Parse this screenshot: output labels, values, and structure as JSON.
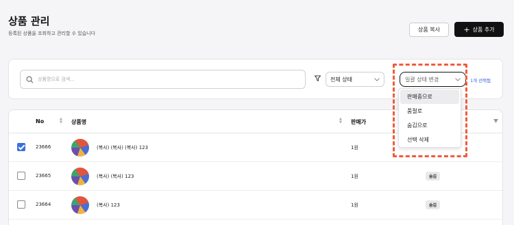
{
  "header": {
    "title": "상품 관리",
    "subtitle": "등록된 상품을 조회하고 관리할 수 있습니다",
    "copy_button": "상품 복사",
    "add_button": "상품 추가",
    "add_icon": "plus-icon"
  },
  "filters": {
    "search_placeholder": "상품명으로 검색...",
    "status_select": "전체 상태",
    "bulk_select": "일괄 상태 변경",
    "selected_count": "1개 선택됨",
    "bulk_options": [
      "판매중으로",
      "품절로",
      "숨김으로",
      "선택 삭제"
    ]
  },
  "table": {
    "columns": {
      "no": "No",
      "name": "상품명",
      "price": "판매가"
    },
    "rows": [
      {
        "checked": true,
        "no": "23666",
        "name": "(복사) (복사) (복사) 123",
        "price": "1원",
        "status": ""
      },
      {
        "checked": false,
        "no": "23665",
        "name": "(복사) (복사) 123",
        "price": "1원",
        "status": "숨김"
      },
      {
        "checked": false,
        "no": "23664",
        "name": "(복사) 123",
        "price": "1원",
        "status": "숨김"
      }
    ]
  },
  "colors": {
    "accent": "#3b5bdb",
    "highlight": "#f05a3a",
    "primary_button": "#111111"
  }
}
